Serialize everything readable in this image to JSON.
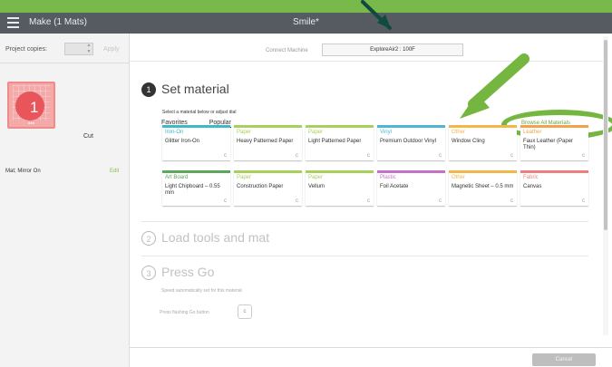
{
  "window": {
    "make_title": "Make (1 Mats)",
    "project_title": "Smile*"
  },
  "sidebar": {
    "copies_label": "Project copies:",
    "apply_label": "Apply",
    "mat_number": "1",
    "mat_action": "Cut",
    "mat_info": "Mat; Mirror On",
    "edit_label": "Edit"
  },
  "machine": {
    "label": "Connect Machine",
    "selected": "ExploreAir2 : 100F"
  },
  "steps": {
    "set_material": {
      "number": "1",
      "title": "Set material"
    },
    "load_tools": {
      "number": "2",
      "title": "Load tools and mat"
    },
    "press_go": {
      "number": "3",
      "title": "Press Go",
      "speed_note": "Speed automatically set for this material",
      "button_note": "Press flashing Go button"
    }
  },
  "materials": {
    "hint": "Select a material below or adjust dial",
    "tabs": [
      {
        "label": "Favorites"
      },
      {
        "label": "Popular"
      }
    ],
    "browse_all_label": "Browse All Materials",
    "cards": [
      {
        "category": "Iron-On",
        "name": "Glitter Iron-On",
        "color": "#3fb8c7"
      },
      {
        "category": "Paper",
        "name": "Heavy Patterned Paper",
        "color": "#a7d15c"
      },
      {
        "category": "Paper",
        "name": "Light Patterned Paper",
        "color": "#a7d15c"
      },
      {
        "category": "Vinyl",
        "name": "Premium Outdoor Vinyl",
        "color": "#4fb6d4"
      },
      {
        "category": "Other",
        "name": "Window Cling",
        "color": "#f2b747"
      },
      {
        "category": "Leather",
        "name": "Faux Leather (Paper Thin)",
        "color": "#f2a24e"
      },
      {
        "category": "Art Board",
        "name": "Light Chipboard – 0.55 mm",
        "color": "#5ba85a"
      },
      {
        "category": "Paper",
        "name": "Construction Paper",
        "color": "#a7d15c"
      },
      {
        "category": "Paper",
        "name": "Vellum",
        "color": "#a7d15c"
      },
      {
        "category": "Plastic",
        "name": "Foil Acetate",
        "color": "#c472c9"
      },
      {
        "category": "Other",
        "name": "Magnetic Sheet – 0.5 mm",
        "color": "#f2b747"
      },
      {
        "category": "Fabric",
        "name": "Canvas",
        "color": "#ef7f7f"
      }
    ]
  },
  "footer": {
    "cancel_label": "Cancel"
  },
  "colors": {
    "accent": "#79b84a",
    "topbar": "#565b61",
    "annotation": "#74b63f"
  }
}
